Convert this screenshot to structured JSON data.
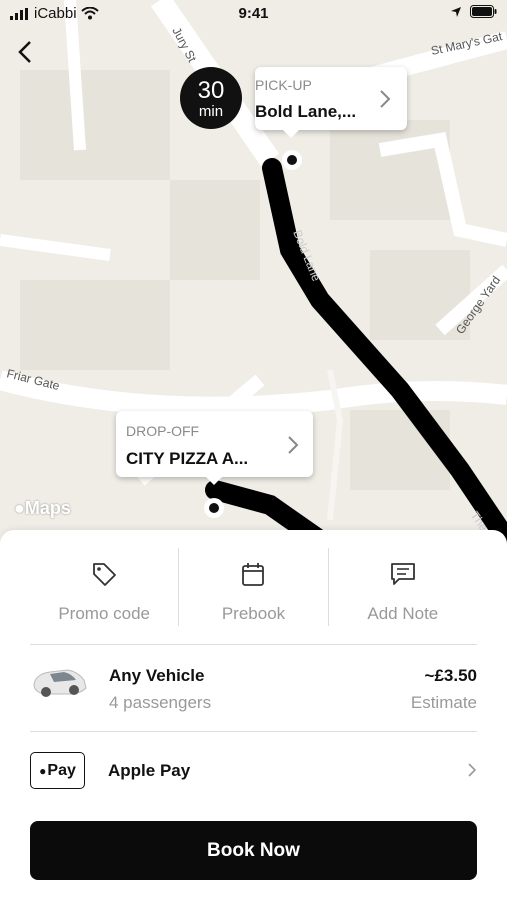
{
  "status_bar": {
    "carrier": "iCabbi",
    "time": "9:41"
  },
  "map": {
    "streets": [
      "Jury St",
      "St Mary's Gat",
      "Bold Lane",
      "George Yard",
      "Friar Gate",
      "The S"
    ],
    "attribution": "Maps"
  },
  "eta": {
    "value": "30",
    "unit": "min"
  },
  "pickup": {
    "label": "PICK-UP",
    "value": "Bold Lane,..."
  },
  "dropoff": {
    "label": "DROP-OFF",
    "value": "CITY PIZZA A..."
  },
  "actions": [
    {
      "label": "Promo code",
      "icon": "tag-icon"
    },
    {
      "label": "Prebook",
      "icon": "calendar-icon"
    },
    {
      "label": "Add Note",
      "icon": "note-icon"
    }
  ],
  "vehicle": {
    "name": "Any Vehicle",
    "passengers": "4 passengers",
    "price": "~£3.50",
    "price_note": "Estimate"
  },
  "payment": {
    "badge": "Pay",
    "method": "Apple Pay"
  },
  "book_button": "Book Now",
  "colors": {
    "primary": "#0b0b0b",
    "map_bg": "#efede6",
    "road": "#ffffff",
    "route": "#000000"
  }
}
